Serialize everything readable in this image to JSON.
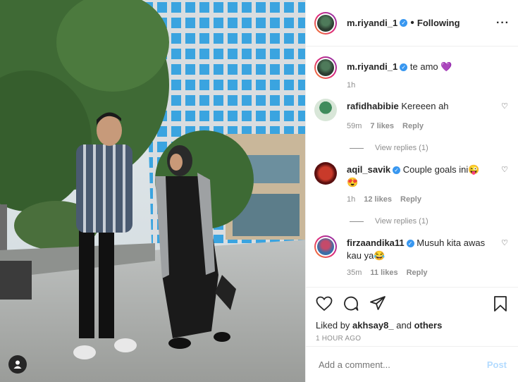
{
  "post": {
    "author": "m.riyandi_1",
    "separator": "•",
    "follow_status": "Following",
    "more_icon": "more-horizontal-icon"
  },
  "caption": {
    "username": "m.riyandi_1",
    "text": "te amo",
    "emoji": "💜",
    "time": "1h"
  },
  "comments": [
    {
      "username": "rafidhabibie",
      "verified": false,
      "text": "Kereeen ah",
      "time": "59m",
      "likes": "7 likes",
      "reply_label": "Reply",
      "view_replies": "View replies (1)"
    },
    {
      "username": "aqil_savik",
      "verified": true,
      "text": "Couple goals ini😜",
      "text2": "😍",
      "time": "1h",
      "likes": "12 likes",
      "reply_label": "Reply",
      "view_replies": "View replies (1)"
    },
    {
      "username": "firzaandika11",
      "verified": true,
      "text": "Musuh kita awas",
      "text2": "kau ya😂",
      "time": "35m",
      "likes": "11 likes",
      "reply_label": "Reply"
    }
  ],
  "liked_by": {
    "prefix": "Liked by",
    "user": "akhsay8_",
    "joiner": "and",
    "others": "others"
  },
  "timestamp": "1 HOUR AGO",
  "add_comment": {
    "placeholder": "Add a comment...",
    "post_label": "Post"
  },
  "colors": {
    "link_blue": "#3897f0",
    "post_disabled": "#b3dbff",
    "muted": "#8e8e8e"
  }
}
